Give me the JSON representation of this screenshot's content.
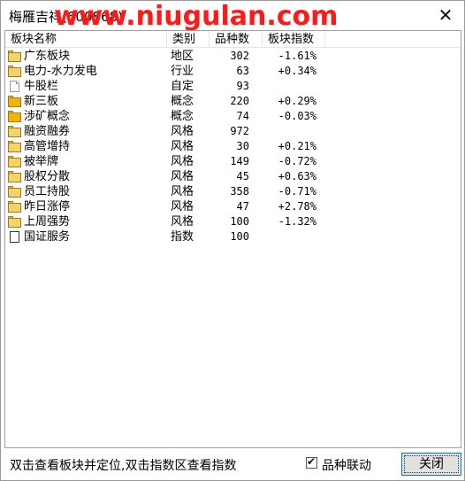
{
  "window": {
    "title": "梅雁吉祥(600868)",
    "watermark": "www.niugulan.com",
    "close_glyph": "✕"
  },
  "list": {
    "headers": [
      "板块名称",
      "类别",
      "品种数",
      "板块指数"
    ],
    "rows": [
      {
        "icon": "folder-icon",
        "name": "广东板块",
        "category": "地区",
        "count": "302",
        "index": "-1.61%"
      },
      {
        "icon": "folder-icon",
        "name": "电力-水力发电",
        "category": "行业",
        "count": "63",
        "index": "+0.34%"
      },
      {
        "icon": "document-icon",
        "name": "牛股栏",
        "category": "自定",
        "count": "93",
        "index": ""
      },
      {
        "icon": "folder-filled-icon",
        "name": "新三板",
        "category": "概念",
        "count": "220",
        "index": "+0.29%"
      },
      {
        "icon": "folder-filled-icon",
        "name": "涉矿概念",
        "category": "概念",
        "count": "74",
        "index": "-0.03%"
      },
      {
        "icon": "folder-icon",
        "name": "融资融券",
        "category": "风格",
        "count": "972",
        "index": ""
      },
      {
        "icon": "folder-icon",
        "name": "高管增持",
        "category": "风格",
        "count": "30",
        "index": "+0.21%"
      },
      {
        "icon": "folder-icon",
        "name": "被举牌",
        "category": "风格",
        "count": "149",
        "index": "-0.72%"
      },
      {
        "icon": "folder-icon",
        "name": "股权分散",
        "category": "风格",
        "count": "45",
        "index": "+0.63%"
      },
      {
        "icon": "folder-icon",
        "name": "员工持股",
        "category": "风格",
        "count": "358",
        "index": "-0.71%"
      },
      {
        "icon": "folder-icon",
        "name": "昨日涨停",
        "category": "风格",
        "count": "47",
        "index": "+2.78%"
      },
      {
        "icon": "folder-icon",
        "name": "上周强势",
        "category": "风格",
        "count": "100",
        "index": "-1.32%"
      },
      {
        "icon": "square-icon",
        "name": "国证服务",
        "category": "指数",
        "count": "100",
        "index": ""
      }
    ]
  },
  "footer": {
    "hint": "双击查看板块并定位,双击指数区查看指数",
    "checkbox_label": "品种联动",
    "checkbox_checked": true,
    "checkbox_glyph": "✔",
    "close_button": "关闭"
  }
}
